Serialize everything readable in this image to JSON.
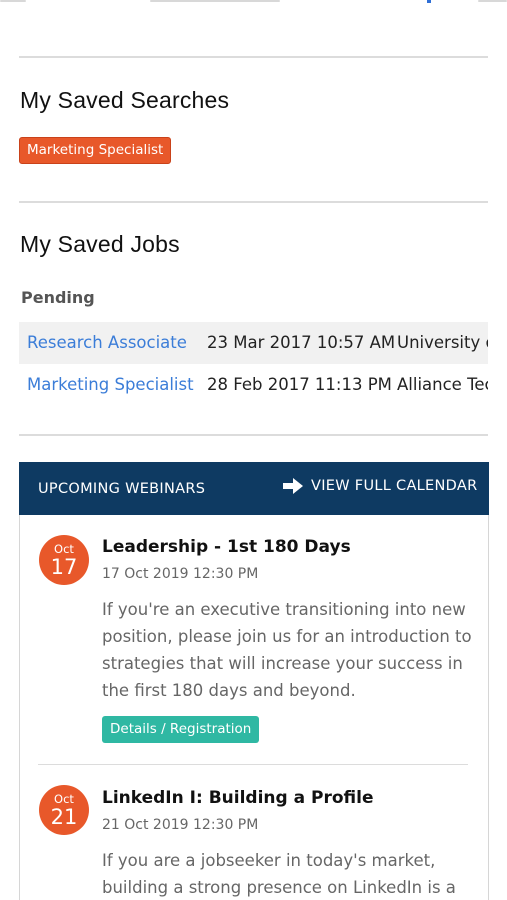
{
  "saved_searches": {
    "title": "My Saved Searches",
    "tags": [
      "Marketing Specialist"
    ]
  },
  "saved_jobs": {
    "title": "My Saved Jobs",
    "group_label": "Pending",
    "rows": [
      {
        "title": "Research Associate",
        "date": "23 Mar 2017 10:57 AM",
        "company": "University of"
      },
      {
        "title": "Marketing Specialist",
        "date": "28 Feb 2017 11:13 PM",
        "company": "Alliance Tech"
      }
    ]
  },
  "webinars": {
    "header_title": "UPCOMING WEBINARS",
    "calendar_link": "VIEW FULL CALENDAR",
    "calendar_icon": "arrow-right-icon",
    "events": [
      {
        "month": "Oct",
        "day": "17",
        "title": "Leadership - 1st 180 Days",
        "datetime": "17 Oct 2019 12:30 PM",
        "description": "If you're an executive transitioning into new position, please join us for an introduction to strategies that will increase your success in the first 180 days and beyond.",
        "button_label": "Details / Registration"
      },
      {
        "month": "Oct",
        "day": "21",
        "title": "LinkedIn I: Building a Profile",
        "datetime": "21 Oct 2019 12:30 PM",
        "description": "If you are a jobseeker in today's market, building a strong presence on LinkedIn is a"
      }
    ]
  },
  "colors": {
    "accent_orange": "#e8582a",
    "header_navy": "#0e3a62",
    "link_blue": "#3b7dd8",
    "button_teal": "#2fb8a3"
  }
}
